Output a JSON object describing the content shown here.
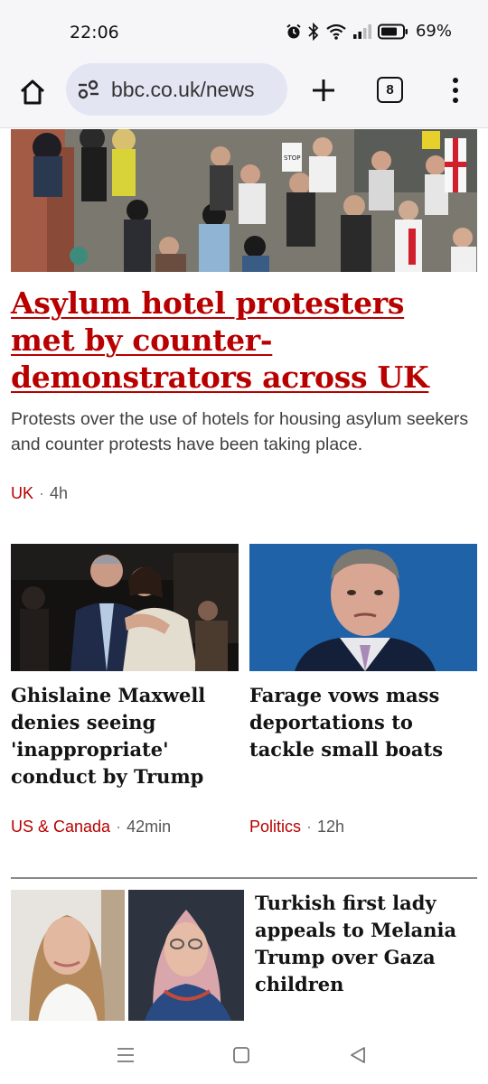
{
  "status_bar": {
    "time": "22:06",
    "battery_percent": "69%",
    "icons": [
      "alarm-icon",
      "bluetooth-icon",
      "wifi-icon",
      "signal-icon",
      "battery-icon"
    ]
  },
  "browser": {
    "url": "bbc.co.uk/news",
    "tab_count": "8",
    "icons": [
      "home-icon",
      "site-settings-icon",
      "new-tab-icon",
      "tabs-icon",
      "more-menu-icon"
    ]
  },
  "hero": {
    "headline": "Asylum hotel protesters met by counter-demonstrators across UK",
    "summary": "Protests over the use of hotels for housing asylum seekers and counter protests have been taking place.",
    "tag": "UK",
    "time": "4h",
    "accent_color": "#b80000"
  },
  "cards": [
    {
      "title": "Ghislaine Maxwell denies seeing 'inappropriate' conduct by Trump",
      "tag": "US & Canada",
      "time": "42min"
    },
    {
      "title": "Farage vows mass deportations to tackle small boats",
      "tag": "Politics",
      "time": "12h"
    }
  ],
  "bottom_story": {
    "title": "Turkish first lady appeals to Melania Trump over Gaza children"
  },
  "nav": {
    "icons": [
      "recent-apps-icon",
      "home-nav-icon",
      "back-icon"
    ]
  }
}
